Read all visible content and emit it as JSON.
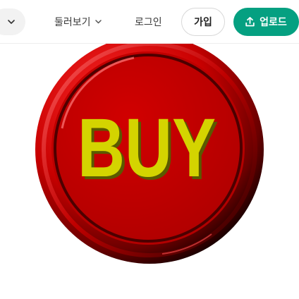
{
  "header": {
    "explore_label": "둘러보기",
    "login_label": "로그인",
    "join_label": "가입",
    "upload_label": "업로드"
  },
  "image": {
    "text": "BUY"
  },
  "colors": {
    "upload_button": "#05a081",
    "button_red": "#c80000",
    "text_yellow": "#d4d400"
  }
}
